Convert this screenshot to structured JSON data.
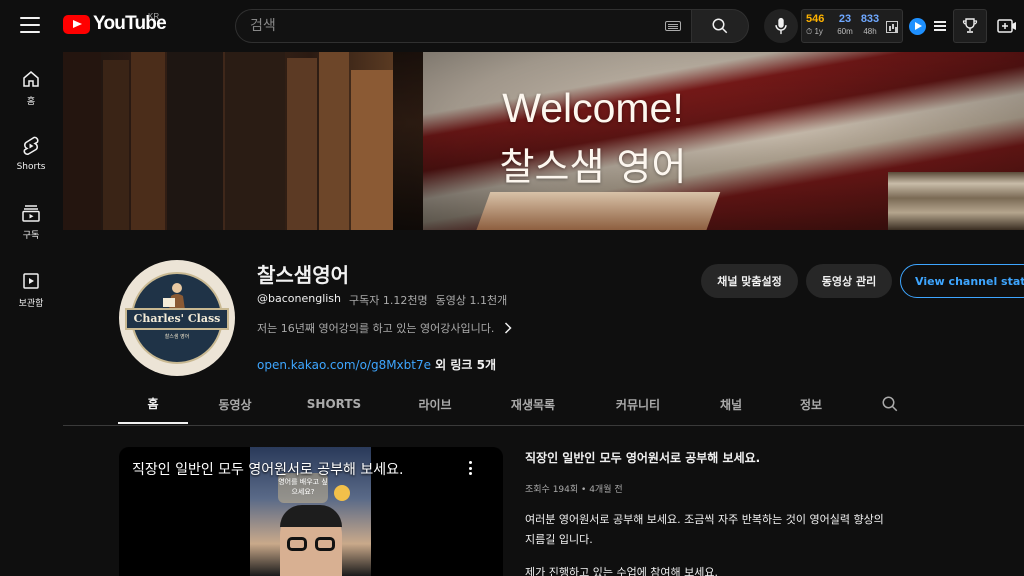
{
  "header": {
    "logo_text": "YouTube",
    "country": "KR",
    "search_placeholder": "검색",
    "stats": [
      {
        "value": "546",
        "label": "⏱ 1y"
      },
      {
        "value": "23",
        "label": "60m"
      },
      {
        "value": "833",
        "label": "48h"
      }
    ],
    "icons": {
      "menu": "hamburger-icon",
      "search": "search-icon",
      "mic": "mic-icon",
      "keyboard": "keyboard-icon",
      "chart": "chart-icon",
      "play": "play-icon",
      "list": "list-icon",
      "trophy": "trophy-icon",
      "create": "create-icon"
    }
  },
  "sidebar": {
    "items": [
      {
        "label": "홈",
        "icon": "home-icon"
      },
      {
        "label": "Shorts",
        "icon": "shorts-icon"
      },
      {
        "label": "구독",
        "icon": "subscriptions-icon"
      },
      {
        "label": "보관함",
        "icon": "library-icon"
      }
    ]
  },
  "banner": {
    "line1": "Welcome!",
    "line2": "찰스샘 영어"
  },
  "channel": {
    "avatar_title": "Charles' Class",
    "avatar_subtitle": "찰스샘 영어",
    "name": "찰스샘영어",
    "handle": "@baconenglish",
    "subscribers": "구독자 1.12천명",
    "videos": "동영상 1.1천개",
    "description": "저는 16년째 영어강의를 하고 있는 영어강사입니다.",
    "link_url": "open.kakao.com/o/g8Mxbt7e",
    "link_more": " 외 링크 5개",
    "buttons": {
      "customize": "채널 맞춤설정",
      "manage": "동영상 관리",
      "stats": "View channel stats"
    }
  },
  "tabs": [
    {
      "label": "홈",
      "active": true
    },
    {
      "label": "동영상",
      "active": false
    },
    {
      "label": "SHORTS",
      "active": false
    },
    {
      "label": "라이브",
      "active": false
    },
    {
      "label": "재생목록",
      "active": false
    },
    {
      "label": "커뮤니티",
      "active": false
    },
    {
      "label": "채널",
      "active": false
    },
    {
      "label": "정보",
      "active": false
    }
  ],
  "featured": {
    "video_title": "직장인 일반인 모두 영어원서로 공부해 보세요.",
    "thumb_text": "영어를 배우고 싶으세요?",
    "info_title": "직장인 일반인 모두 영어원서로 공부해 보세요.",
    "meta": "조회수 194회 • 4개월 전",
    "description": "여러분 영어원서로 공부해 보세요. 조금씩 자주 반복하는 것이 영어실력 향상의 지름길 입니다.",
    "description2": "제가 진행하고 있는 수업에 참여해 보세요."
  },
  "colors": {
    "background": "#0f0f0f",
    "accent_blue": "#3ea6ff",
    "brand_red": "#ff0000",
    "stat_orange": "#ffb300"
  }
}
